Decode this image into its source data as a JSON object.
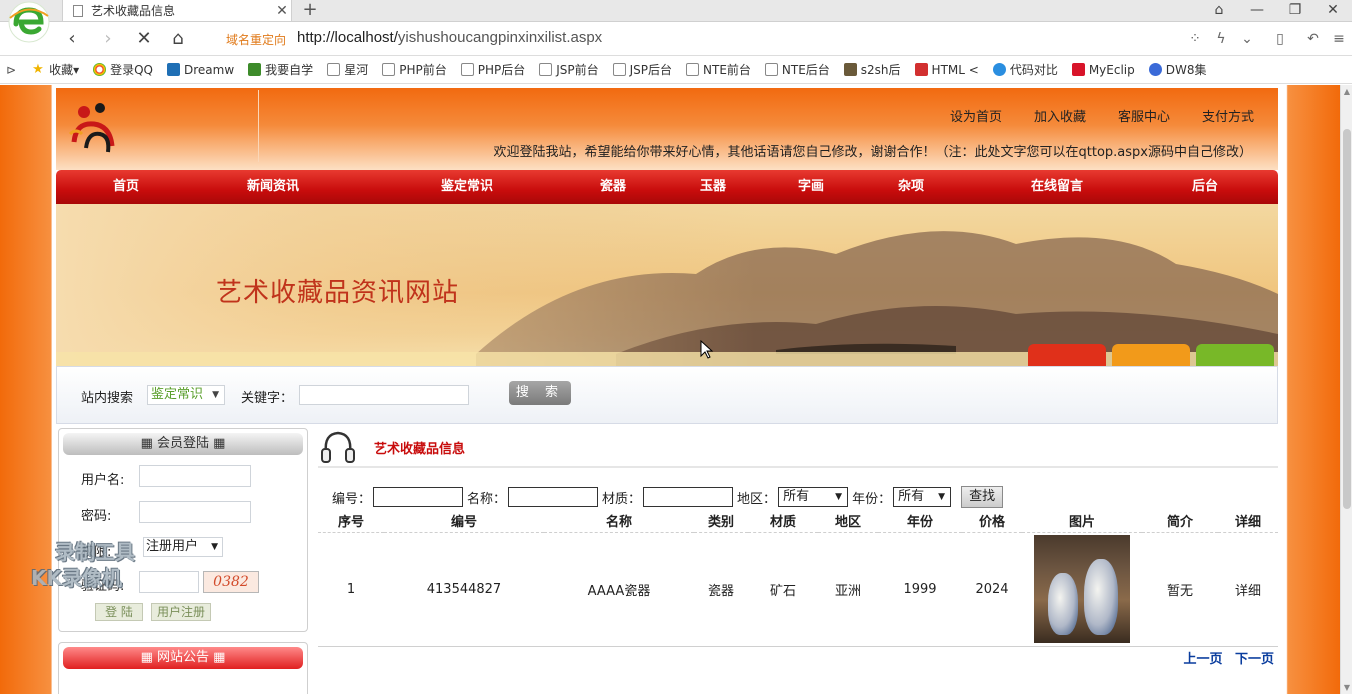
{
  "browser": {
    "tab_title": "艺术收藏品信息",
    "redirect_label": "域名重定向",
    "url_host": "http://localhost/",
    "url_path": "yishushoucangpinxinxilist.aspx",
    "bookmarks": [
      "收藏",
      "登录QQ",
      "Dreamw",
      "我要自学",
      "星河",
      "PHP前台",
      "PHP后台",
      "JSP前台",
      "JSP后台",
      "NTE前台",
      "NTE后台",
      "s2sh后",
      "HTML <",
      "代码对比",
      "MyEclip",
      "DW8集"
    ]
  },
  "header": {
    "links": [
      "设为首页",
      "加入收藏",
      "客服中心",
      "支付方式"
    ],
    "welcome": "欢迎登陆我站，希望能给你带来好心情，其他话语请您自己修改，谢谢合作！（注：此处文字您可以在qttop.aspx源码中自己修改）"
  },
  "nav": [
    "首页",
    "新闻资讯",
    "鉴定常识",
    "瓷器",
    "玉器",
    "字画",
    "杂项",
    "在线留言",
    "后台"
  ],
  "banner": {
    "title": "艺术收藏品资讯网站"
  },
  "search": {
    "label": "站内搜索",
    "category": "鉴定常识",
    "keyword_label": "关键字：",
    "button": "搜 索"
  },
  "login": {
    "title": "▦ 会员登陆 ▦",
    "username_label": "用户名:",
    "password_label": "密码:",
    "role_label": "权限:",
    "role_value": "注册用户",
    "captcha_label": "验证码:",
    "captcha_value": "0382",
    "login_button": "登 陆",
    "register_button": "用户注册",
    "watermark": [
      "录制工具",
      "KK录像机"
    ]
  },
  "notice": {
    "title": "▦ 网站公告 ▦"
  },
  "main": {
    "title": "艺术收藏品信息",
    "filters": {
      "code_label": "编号：",
      "name_label": "名称：",
      "material_label": "材质：",
      "region_label": "地区：",
      "region_value": "所有",
      "year_label": "年份：",
      "year_value": "所有",
      "search_button": "查找"
    },
    "columns": [
      "序号",
      "编号",
      "名称",
      "类别",
      "材质",
      "地区",
      "年份",
      "价格",
      "图片",
      "简介",
      "详细"
    ],
    "rows": [
      {
        "idx": "1",
        "code": "413544827",
        "name": "AAAA瓷器",
        "category": "瓷器",
        "material": "矿石",
        "region": "亚洲",
        "year": "1999",
        "price": "2024",
        "intro": "暂无",
        "detail": "详细"
      }
    ],
    "prev": "上一页",
    "next": "下一页"
  }
}
